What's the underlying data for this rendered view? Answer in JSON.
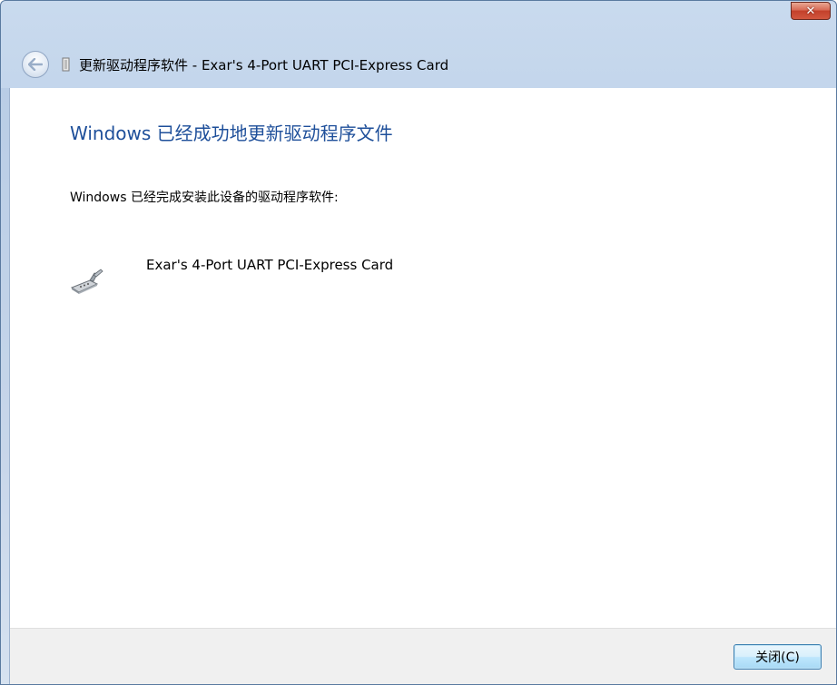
{
  "window": {
    "close_glyph": "✕",
    "header_title": "更新驱动程序软件 - Exar's 4-Port UART PCI-Express Card"
  },
  "content": {
    "heading": "Windows 已经成功地更新驱动程序文件",
    "message": "Windows 已经完成安装此设备的驱动程序软件:",
    "device_name": "Exar's 4-Port UART PCI-Express Card",
    "device_icon": "serial-port-cable-icon"
  },
  "footer": {
    "close_button_label": "关闭(C)"
  },
  "colors": {
    "heading": "#1e4f9a",
    "close_button_border": "#3c7fb1",
    "titlebar_close": "#c3402a"
  }
}
